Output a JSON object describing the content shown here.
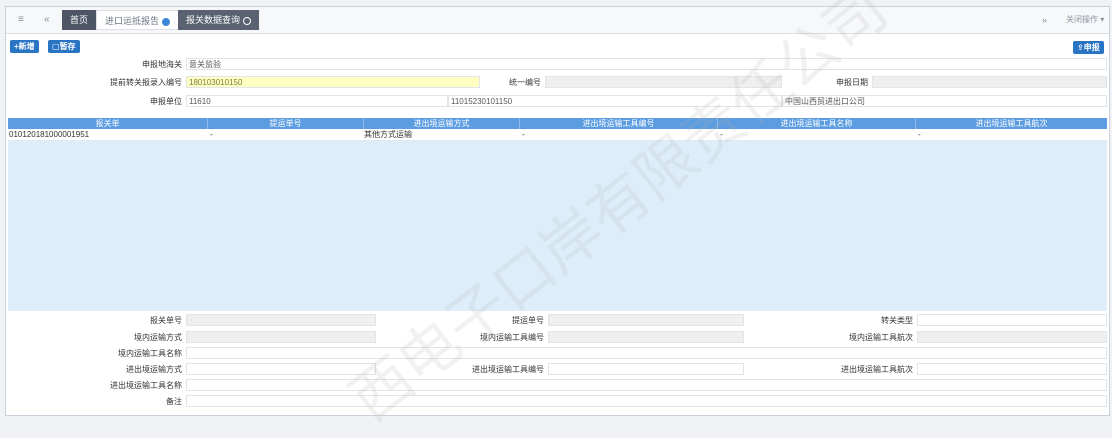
{
  "tabbar": {
    "home": "首页",
    "import_tab": "进口运抵报告",
    "query_tab": "报关数据查询",
    "close_ops": "关闭操作"
  },
  "toolbar": {
    "new_label": "+新增",
    "save_label": "暂存",
    "declare_label": "申报"
  },
  "form_top": {
    "customs_label": "申报地海关",
    "customs_value": "意关监验",
    "transfer_no_label": "提前转关报录入编号",
    "transfer_no_value": "180103010150",
    "unified_no_label": "统一编号",
    "declare_date_label": "申报日期",
    "declare_unit_label": "申报单位",
    "declare_unit_code": "11610",
    "declare_unit_code2": "11015230101150",
    "declare_unit_name": "中国山西贸进出口公司"
  },
  "grid": {
    "headers": [
      "报关单",
      "提运单号",
      "进出境运输方式",
      "进出境运输工具编号",
      "进出境运输工具名称",
      "进出境运输工具航次"
    ],
    "rows": [
      {
        "c1": "010120181000001951",
        "c2": "-",
        "c3": "其他方式运输",
        "c4": "-",
        "c5": "-",
        "c6": "-"
      }
    ]
  },
  "form_bottom": {
    "decl_no_label": "报关单号",
    "bl_no_label": "提运单号",
    "transfer_type_label": "转关类型",
    "domestic_mode_label": "境内运输方式",
    "domestic_tool_no_label": "境内运输工具编号",
    "domestic_voyage_label": "境内运输工具航次",
    "domestic_tool_name_label": "境内运输工具名称",
    "inout_mode_label": "进出境运输方式",
    "inout_tool_no_label": "进出境运输工具编号",
    "inout_voyage_label": "进出境运输工具航次",
    "inout_tool_name_label": "进出境运输工具名称",
    "remark_label": "备注"
  },
  "watermark": "西电子口岸有限责任公司"
}
